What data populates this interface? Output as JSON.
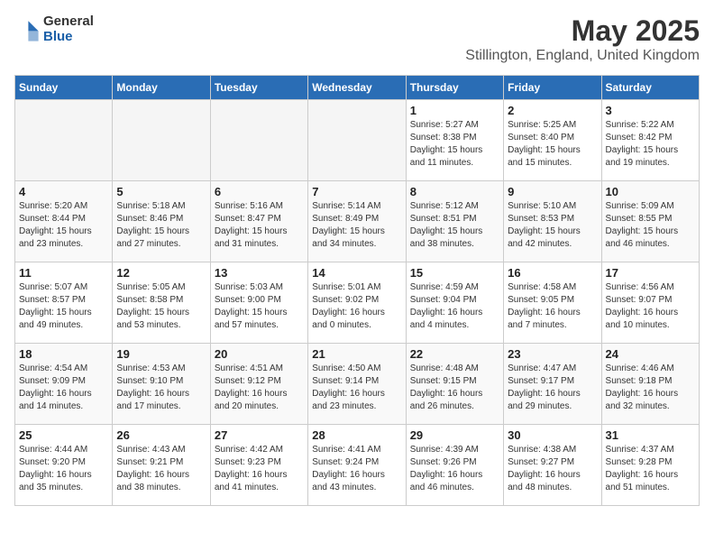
{
  "logo": {
    "general": "General",
    "blue": "Blue"
  },
  "title": "May 2025",
  "location": "Stillington, England, United Kingdom",
  "headers": [
    "Sunday",
    "Monday",
    "Tuesday",
    "Wednesday",
    "Thursday",
    "Friday",
    "Saturday"
  ],
  "weeks": [
    [
      {
        "day": "",
        "info": ""
      },
      {
        "day": "",
        "info": ""
      },
      {
        "day": "",
        "info": ""
      },
      {
        "day": "",
        "info": ""
      },
      {
        "day": "1",
        "info": "Sunrise: 5:27 AM\nSunset: 8:38 PM\nDaylight: 15 hours\nand 11 minutes."
      },
      {
        "day": "2",
        "info": "Sunrise: 5:25 AM\nSunset: 8:40 PM\nDaylight: 15 hours\nand 15 minutes."
      },
      {
        "day": "3",
        "info": "Sunrise: 5:22 AM\nSunset: 8:42 PM\nDaylight: 15 hours\nand 19 minutes."
      }
    ],
    [
      {
        "day": "4",
        "info": "Sunrise: 5:20 AM\nSunset: 8:44 PM\nDaylight: 15 hours\nand 23 minutes."
      },
      {
        "day": "5",
        "info": "Sunrise: 5:18 AM\nSunset: 8:46 PM\nDaylight: 15 hours\nand 27 minutes."
      },
      {
        "day": "6",
        "info": "Sunrise: 5:16 AM\nSunset: 8:47 PM\nDaylight: 15 hours\nand 31 minutes."
      },
      {
        "day": "7",
        "info": "Sunrise: 5:14 AM\nSunset: 8:49 PM\nDaylight: 15 hours\nand 34 minutes."
      },
      {
        "day": "8",
        "info": "Sunrise: 5:12 AM\nSunset: 8:51 PM\nDaylight: 15 hours\nand 38 minutes."
      },
      {
        "day": "9",
        "info": "Sunrise: 5:10 AM\nSunset: 8:53 PM\nDaylight: 15 hours\nand 42 minutes."
      },
      {
        "day": "10",
        "info": "Sunrise: 5:09 AM\nSunset: 8:55 PM\nDaylight: 15 hours\nand 46 minutes."
      }
    ],
    [
      {
        "day": "11",
        "info": "Sunrise: 5:07 AM\nSunset: 8:57 PM\nDaylight: 15 hours\nand 49 minutes."
      },
      {
        "day": "12",
        "info": "Sunrise: 5:05 AM\nSunset: 8:58 PM\nDaylight: 15 hours\nand 53 minutes."
      },
      {
        "day": "13",
        "info": "Sunrise: 5:03 AM\nSunset: 9:00 PM\nDaylight: 15 hours\nand 57 minutes."
      },
      {
        "day": "14",
        "info": "Sunrise: 5:01 AM\nSunset: 9:02 PM\nDaylight: 16 hours\nand 0 minutes."
      },
      {
        "day": "15",
        "info": "Sunrise: 4:59 AM\nSunset: 9:04 PM\nDaylight: 16 hours\nand 4 minutes."
      },
      {
        "day": "16",
        "info": "Sunrise: 4:58 AM\nSunset: 9:05 PM\nDaylight: 16 hours\nand 7 minutes."
      },
      {
        "day": "17",
        "info": "Sunrise: 4:56 AM\nSunset: 9:07 PM\nDaylight: 16 hours\nand 10 minutes."
      }
    ],
    [
      {
        "day": "18",
        "info": "Sunrise: 4:54 AM\nSunset: 9:09 PM\nDaylight: 16 hours\nand 14 minutes."
      },
      {
        "day": "19",
        "info": "Sunrise: 4:53 AM\nSunset: 9:10 PM\nDaylight: 16 hours\nand 17 minutes."
      },
      {
        "day": "20",
        "info": "Sunrise: 4:51 AM\nSunset: 9:12 PM\nDaylight: 16 hours\nand 20 minutes."
      },
      {
        "day": "21",
        "info": "Sunrise: 4:50 AM\nSunset: 9:14 PM\nDaylight: 16 hours\nand 23 minutes."
      },
      {
        "day": "22",
        "info": "Sunrise: 4:48 AM\nSunset: 9:15 PM\nDaylight: 16 hours\nand 26 minutes."
      },
      {
        "day": "23",
        "info": "Sunrise: 4:47 AM\nSunset: 9:17 PM\nDaylight: 16 hours\nand 29 minutes."
      },
      {
        "day": "24",
        "info": "Sunrise: 4:46 AM\nSunset: 9:18 PM\nDaylight: 16 hours\nand 32 minutes."
      }
    ],
    [
      {
        "day": "25",
        "info": "Sunrise: 4:44 AM\nSunset: 9:20 PM\nDaylight: 16 hours\nand 35 minutes."
      },
      {
        "day": "26",
        "info": "Sunrise: 4:43 AM\nSunset: 9:21 PM\nDaylight: 16 hours\nand 38 minutes."
      },
      {
        "day": "27",
        "info": "Sunrise: 4:42 AM\nSunset: 9:23 PM\nDaylight: 16 hours\nand 41 minutes."
      },
      {
        "day": "28",
        "info": "Sunrise: 4:41 AM\nSunset: 9:24 PM\nDaylight: 16 hours\nand 43 minutes."
      },
      {
        "day": "29",
        "info": "Sunrise: 4:39 AM\nSunset: 9:26 PM\nDaylight: 16 hours\nand 46 minutes."
      },
      {
        "day": "30",
        "info": "Sunrise: 4:38 AM\nSunset: 9:27 PM\nDaylight: 16 hours\nand 48 minutes."
      },
      {
        "day": "31",
        "info": "Sunrise: 4:37 AM\nSunset: 9:28 PM\nDaylight: 16 hours\nand 51 minutes."
      }
    ]
  ]
}
